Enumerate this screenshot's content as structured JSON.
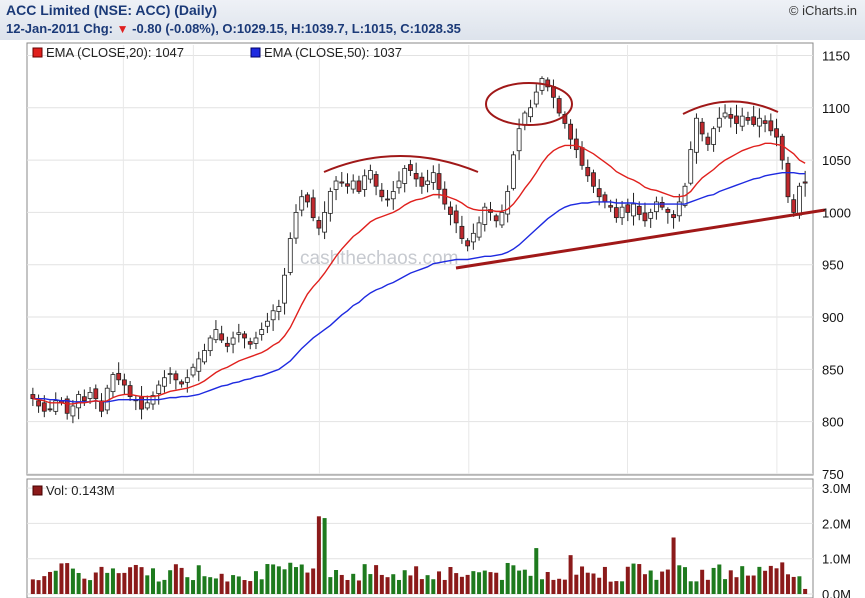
{
  "header": {
    "title": "ACC Limited (NSE: ACC) (Daily)",
    "date": "12-Jan-2011",
    "chg_label": "Chg:",
    "chg_value": "-0.80 (-0.08%)",
    "ohlc": ", O:1029.15, H:1039.7, L:1015, C:1028.35",
    "source": "© iCharts.in"
  },
  "legend": {
    "ema20": "EMA (CLOSE,20): 1047",
    "ema50": "EMA (CLOSE,50): 1037",
    "vol": "Vol: 0.143M"
  },
  "watermark": "cashthechaos.com",
  "colors": {
    "up": "#ffffff",
    "down": "#c0282d",
    "ema20": "#e0201d",
    "ema50": "#1e2ae0",
    "trend": "#a01818",
    "vol_up": "#1e7a1e",
    "vol_down": "#8b1a1a"
  },
  "chart_data": {
    "type": "candlestick",
    "price_ticks": [
      "1150",
      "1100",
      "1050",
      "1000",
      "950",
      "900",
      "850",
      "800",
      "750"
    ],
    "volume_ticks": [
      "3.0M",
      "2.0M",
      "1.0M",
      "0.0M"
    ],
    "price_range": [
      750,
      1160
    ],
    "volume_range": [
      0,
      3.2
    ],
    "ema20_last": 1047,
    "ema50_last": 1037,
    "last_bar": {
      "date": "12-Jan-2011",
      "open": 1029.15,
      "high": 1039.7,
      "low": 1015,
      "close": 1028.35,
      "volume_m": 0.143
    },
    "close": [
      822,
      815,
      810,
      812,
      820,
      818,
      808,
      815,
      826,
      820,
      828,
      822,
      810,
      832,
      845,
      840,
      835,
      824,
      820,
      812,
      818,
      825,
      835,
      842,
      846,
      840,
      836,
      842,
      852,
      860,
      868,
      880,
      888,
      878,
      872,
      880,
      885,
      880,
      874,
      880,
      888,
      896,
      906,
      910,
      940,
      975,
      1000,
      1015,
      1010,
      995,
      985,
      1000,
      1020,
      1030,
      1028,
      1025,
      1030,
      1020,
      1035,
      1040,
      1025,
      1015,
      1012,
      1020,
      1030,
      1042,
      1040,
      1032,
      1025,
      1030,
      1038,
      1022,
      1008,
      998,
      990,
      975,
      968,
      980,
      990,
      1005,
      1000,
      992,
      1000,
      1020,
      1055,
      1080,
      1095,
      1100,
      1115,
      1128,
      1120,
      1110,
      1095,
      1085,
      1070,
      1060,
      1045,
      1035,
      1025,
      1015,
      1010,
      1005,
      995,
      1005,
      1000,
      1008,
      998,
      992,
      1000,
      1010,
      1005,
      1000,
      995,
      1010,
      1025,
      1060,
      1090,
      1075,
      1065,
      1080,
      1090,
      1095,
      1090,
      1085,
      1092,
      1088,
      1084,
      1090,
      1085,
      1078,
      1072,
      1050,
      1015,
      1000,
      1025,
      1028
    ],
    "ema20": [
      822,
      821,
      820,
      818,
      818,
      818,
      817,
      817,
      818,
      818,
      819,
      820,
      819,
      820,
      823,
      825,
      826,
      826,
      825,
      824,
      824,
      824,
      825,
      827,
      829,
      830,
      831,
      832,
      834,
      836,
      839,
      843,
      847,
      850,
      852,
      855,
      858,
      860,
      862,
      864,
      866,
      869,
      873,
      876,
      882,
      890,
      901,
      912,
      922,
      929,
      935,
      942,
      950,
      958,
      965,
      971,
      977,
      981,
      986,
      991,
      994,
      996,
      998,
      1000,
      1003,
      1007,
      1010,
      1012,
      1013,
      1015,
      1017,
      1017,
      1016,
      1014,
      1012,
      1009,
      1005,
      1003,
      1002,
      1002,
      1002,
      1001,
      1001,
      1003,
      1008,
      1015,
      1023,
      1030,
      1038,
      1047,
      1054,
      1059,
      1062,
      1064,
      1064,
      1064,
      1062,
      1059,
      1056,
      1052,
      1048,
      1044,
      1039,
      1036,
      1033,
      1031,
      1028,
      1024,
      1022,
      1021,
      1019,
      1017,
      1015,
      1015,
      1016,
      1020,
      1027,
      1033,
      1037,
      1041,
      1046,
      1050,
      1053,
      1056,
      1059,
      1061,
      1063,
      1064,
      1066,
      1066,
      1065,
      1064,
      1060,
      1056,
      1050,
      1047
    ],
    "ema50": [
      822,
      822,
      822,
      821,
      821,
      820,
      820,
      819,
      819,
      819,
      819,
      820,
      819,
      819,
      820,
      821,
      821,
      821,
      821,
      821,
      821,
      821,
      821,
      822,
      823,
      823,
      824,
      824,
      825,
      826,
      828,
      830,
      832,
      834,
      835,
      837,
      838,
      840,
      841,
      843,
      844,
      846,
      848,
      850,
      854,
      858,
      864,
      870,
      875,
      880,
      884,
      888,
      892,
      897,
      902,
      906,
      911,
      914,
      919,
      923,
      926,
      928,
      931,
      933,
      936,
      939,
      942,
      944,
      946,
      948,
      951,
      952,
      953,
      954,
      955,
      955,
      955,
      956,
      957,
      958,
      958,
      959,
      960,
      962,
      965,
      969,
      974,
      979,
      984,
      989,
      994,
      998,
      1002,
      1005,
      1007,
      1008,
      1009,
      1009,
      1010,
      1010,
      1010,
      1010,
      1009,
      1009,
      1009,
      1009,
      1008,
      1008,
      1008,
      1008,
      1008,
      1008,
      1008,
      1008,
      1008,
      1010,
      1012,
      1014,
      1016,
      1017,
      1020,
      1022,
      1024,
      1026,
      1028,
      1030,
      1032,
      1033,
      1035,
      1036,
      1037,
      1038,
      1038,
      1038,
      1037,
      1037
    ]
  }
}
